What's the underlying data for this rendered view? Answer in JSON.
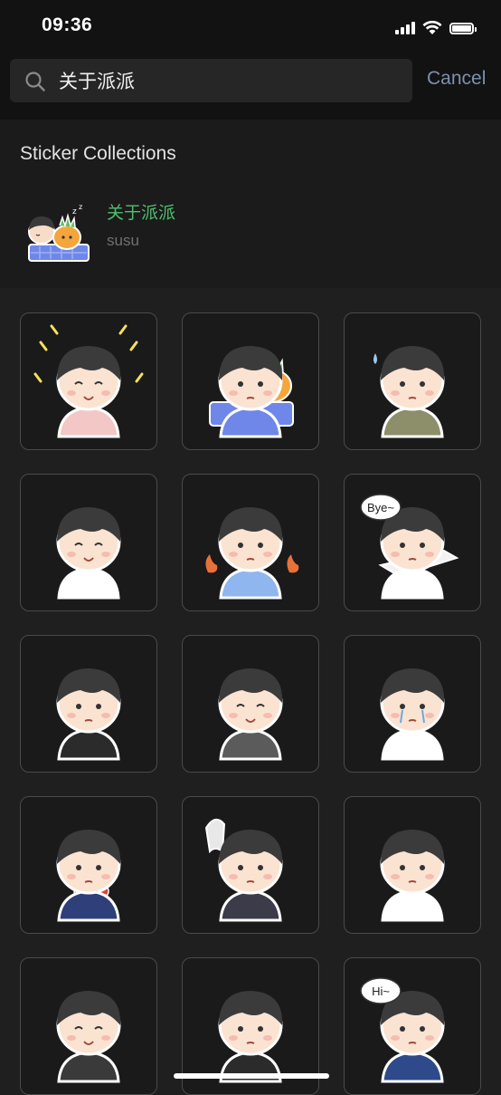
{
  "status_bar": {
    "time": "09:36"
  },
  "search": {
    "query": "关于派派",
    "cancel_label": "Cancel"
  },
  "collections": {
    "title": "Sticker Collections",
    "items": [
      {
        "name": "关于派派",
        "author": "susu"
      }
    ]
  },
  "stickers": [
    {
      "name": "sticker-cheering",
      "bubble": ""
    },
    {
      "name": "sticker-sleeping-carrot",
      "bubble": ""
    },
    {
      "name": "sticker-sweating",
      "bubble": ""
    },
    {
      "name": "sticker-headband-flags",
      "bubble": ""
    },
    {
      "name": "sticker-angry-fire",
      "bubble": ""
    },
    {
      "name": "sticker-airplane-bye",
      "bubble": "Bye~"
    },
    {
      "name": "sticker-heart-hands",
      "bubble": ""
    },
    {
      "name": "sticker-laughing-haha",
      "bubble": ""
    },
    {
      "name": "sticker-crying",
      "bubble": ""
    },
    {
      "name": "sticker-flower-bouquet",
      "bubble": ""
    },
    {
      "name": "sticker-ghost-shock",
      "bubble": ""
    },
    {
      "name": "sticker-salute-received",
      "bubble": ""
    },
    {
      "name": "sticker-happy-sparkle",
      "bubble": ""
    },
    {
      "name": "sticker-arms-crossed",
      "bubble": ""
    },
    {
      "name": "sticker-hi-wave",
      "bubble": "Hi~"
    }
  ],
  "colors": {
    "accent_green": "#4fbf70",
    "cancel_blue": "#7d90ad",
    "background": "#1f1f1f"
  }
}
